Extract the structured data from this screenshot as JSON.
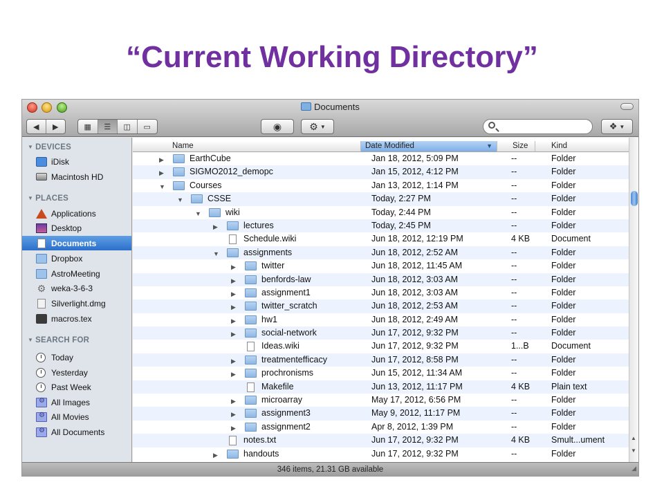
{
  "slide": {
    "title": "“Current Working Directory”"
  },
  "window": {
    "title": "Documents",
    "status": "346 items, 21.31 GB available",
    "search_placeholder": ""
  },
  "toolbar": {
    "back_icon": "back-arrow-icon",
    "forward_icon": "forward-arrow-icon",
    "view_modes": [
      "icon-view-icon",
      "list-view-icon",
      "column-view-icon",
      "coverflow-view-icon"
    ],
    "quicklook_icon": "eye-icon",
    "action_icon": "gear-icon",
    "dropbox_icon": "dropbox-icon"
  },
  "columns": {
    "name": "Name",
    "date": "Date Modified",
    "size": "Size",
    "kind": "Kind"
  },
  "sidebar": {
    "sections": [
      {
        "heading": "DEVICES",
        "items": [
          {
            "label": "iDisk",
            "icon": "idisk-icon"
          },
          {
            "label": "Macintosh HD",
            "icon": "harddisk-icon"
          }
        ]
      },
      {
        "heading": "PLACES",
        "items": [
          {
            "label": "Applications",
            "icon": "applications-icon"
          },
          {
            "label": "Desktop",
            "icon": "desktop-icon"
          },
          {
            "label": "Documents",
            "icon": "documents-icon",
            "selected": true
          },
          {
            "label": "Dropbox",
            "icon": "folder-icon"
          },
          {
            "label": "AstroMeeting",
            "icon": "folder-icon"
          },
          {
            "label": "weka-3-6-3",
            "icon": "gear-icon"
          },
          {
            "label": "Silverlight.dmg",
            "icon": "dmg-file-icon"
          },
          {
            "label": "macros.tex",
            "icon": "tex-file-icon"
          }
        ]
      },
      {
        "heading": "SEARCH FOR",
        "items": [
          {
            "label": "Today",
            "icon": "clock-icon"
          },
          {
            "label": "Yesterday",
            "icon": "clock-icon"
          },
          {
            "label": "Past Week",
            "icon": "clock-icon"
          },
          {
            "label": "All Images",
            "icon": "smart-folder-icon"
          },
          {
            "label": "All Movies",
            "icon": "smart-folder-icon"
          },
          {
            "label": "All Documents",
            "icon": "smart-folder-icon"
          }
        ]
      }
    ]
  },
  "files": [
    {
      "name": "EarthCube",
      "depth": 0,
      "type": "folder",
      "expanded": false,
      "date": "Jan 18, 2012, 5:09 PM",
      "size": "--",
      "kind": "Folder"
    },
    {
      "name": "SIGMO2012_demopc",
      "depth": 0,
      "type": "folder",
      "expanded": false,
      "date": "Jan 15, 2012, 4:12 PM",
      "size": "--",
      "kind": "Folder"
    },
    {
      "name": "Courses",
      "depth": 0,
      "type": "folder",
      "expanded": true,
      "date": "Jan 13, 2012, 1:14 PM",
      "size": "--",
      "kind": "Folder"
    },
    {
      "name": "CSSE",
      "depth": 1,
      "type": "folder",
      "expanded": true,
      "date": "Today, 2:27 PM",
      "size": "--",
      "kind": "Folder"
    },
    {
      "name": "wiki",
      "depth": 2,
      "type": "folder",
      "expanded": true,
      "date": "Today, 2:44 PM",
      "size": "--",
      "kind": "Folder"
    },
    {
      "name": "lectures",
      "depth": 3,
      "type": "folder",
      "expanded": false,
      "date": "Today, 2:45 PM",
      "size": "--",
      "kind": "Folder"
    },
    {
      "name": "Schedule.wiki",
      "depth": 3,
      "type": "file",
      "date": "Jun 18, 2012, 12:19 PM",
      "size": "4 KB",
      "kind": "Document"
    },
    {
      "name": "assignments",
      "depth": 3,
      "type": "folder",
      "expanded": true,
      "date": "Jun 18, 2012, 2:52 AM",
      "size": "--",
      "kind": "Folder"
    },
    {
      "name": "twitter",
      "depth": 4,
      "type": "folder",
      "expanded": false,
      "date": "Jun 18, 2012, 11:45 AM",
      "size": "--",
      "kind": "Folder"
    },
    {
      "name": "benfords-law",
      "depth": 4,
      "type": "folder",
      "expanded": false,
      "date": "Jun 18, 2012, 3:03 AM",
      "size": "--",
      "kind": "Folder"
    },
    {
      "name": "assignment1",
      "depth": 4,
      "type": "folder",
      "expanded": false,
      "date": "Jun 18, 2012, 3:03 AM",
      "size": "--",
      "kind": "Folder"
    },
    {
      "name": "twitter_scratch",
      "depth": 4,
      "type": "folder",
      "expanded": false,
      "date": "Jun 18, 2012, 2:53 AM",
      "size": "--",
      "kind": "Folder"
    },
    {
      "name": "hw1",
      "depth": 4,
      "type": "folder",
      "expanded": false,
      "date": "Jun 18, 2012, 2:49 AM",
      "size": "--",
      "kind": "Folder"
    },
    {
      "name": "social-network",
      "depth": 4,
      "type": "folder",
      "expanded": false,
      "date": "Jun 17, 2012, 9:32 PM",
      "size": "--",
      "kind": "Folder"
    },
    {
      "name": "Ideas.wiki",
      "depth": 4,
      "type": "file",
      "date": "Jun 17, 2012, 9:32 PM",
      "size": "1...B",
      "kind": "Document"
    },
    {
      "name": "treatmentefficacy",
      "depth": 4,
      "type": "folder",
      "expanded": false,
      "date": "Jun 17, 2012, 8:58 PM",
      "size": "--",
      "kind": "Folder"
    },
    {
      "name": "prochronisms",
      "depth": 4,
      "type": "folder",
      "expanded": false,
      "date": "Jun 15, 2012, 11:34 AM",
      "size": "--",
      "kind": "Folder"
    },
    {
      "name": "Makefile",
      "depth": 4,
      "type": "file",
      "date": "Jun 13, 2012, 11:17 PM",
      "size": "4 KB",
      "kind": "Plain text"
    },
    {
      "name": "microarray",
      "depth": 4,
      "type": "folder",
      "expanded": false,
      "date": "May 17, 2012, 6:56 PM",
      "size": "--",
      "kind": "Folder"
    },
    {
      "name": "assignment3",
      "depth": 4,
      "type": "folder",
      "expanded": false,
      "date": "May 9, 2012, 11:17 PM",
      "size": "--",
      "kind": "Folder"
    },
    {
      "name": "assignment2",
      "depth": 4,
      "type": "folder",
      "expanded": false,
      "date": "Apr 8, 2012, 1:39 PM",
      "size": "--",
      "kind": "Folder"
    },
    {
      "name": "notes.txt",
      "depth": 3,
      "type": "file",
      "date": "Jun 17, 2012, 9:32 PM",
      "size": "4 KB",
      "kind": "Smult...ument"
    },
    {
      "name": "handouts",
      "depth": 3,
      "type": "folder",
      "expanded": false,
      "date": "Jun 17, 2012, 9:32 PM",
      "size": "--",
      "kind": "Folder"
    }
  ]
}
